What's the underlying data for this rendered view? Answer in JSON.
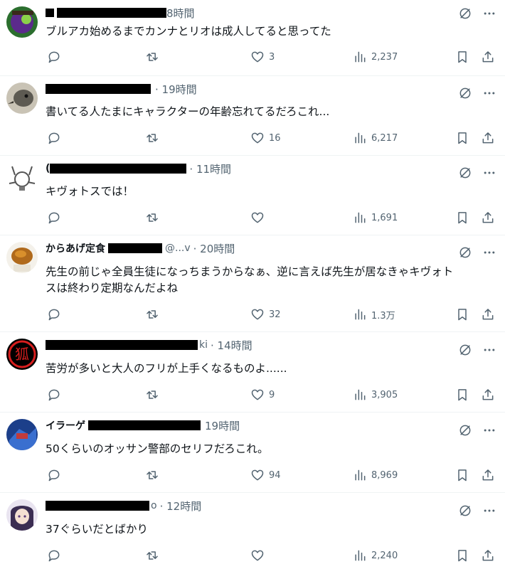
{
  "tweets": [
    {
      "name_visible": "",
      "handle_visible": "",
      "time": "8時間",
      "text": "ブルアカ始めるまでカンナとリオは成人してると思ってた",
      "likes": "3",
      "views": "2,237",
      "replies": "",
      "retweets": ""
    },
    {
      "name_visible": "",
      "handle_visible": "",
      "time": "· 19時間",
      "text": "書いてる人たまにキャラクターの年齢忘れてるだろこれ...",
      "likes": "16",
      "views": "6,217",
      "replies": "",
      "retweets": ""
    },
    {
      "name_visible": "(",
      "handle_visible": "",
      "time": "· 11時間",
      "text": "キヴォトスでは！",
      "likes": "",
      "views": "1,691",
      "replies": "",
      "retweets": ""
    },
    {
      "name_visible": "からあげ定食",
      "handle_visible": "@...v",
      "time": "· 20時間",
      "text": "先生の前じゃ全員生徒になっちまうからなぁ、逆に言えば先生が居なきゃキヴォトスは終わり定期なんだよね",
      "likes": "32",
      "views": "1.3万",
      "replies": "",
      "retweets": ""
    },
    {
      "name_visible": "",
      "handle_visible": "ki",
      "time": "· 14時間",
      "text": "苦労が多いと大人のフリが上手くなるものよ......",
      "likes": "9",
      "views": "3,905",
      "replies": "",
      "retweets": ""
    },
    {
      "name_visible": "イラーゲ",
      "handle_visible": "",
      "time": "19時間",
      "text": "50くらいのオッサン警部のセリフだろこれ。",
      "likes": "94",
      "views": "8,969",
      "replies": "",
      "retweets": ""
    },
    {
      "name_visible": "",
      "handle_visible": "o",
      "time": "· 12時間",
      "text": "37ぐらいだとばかり",
      "likes": "",
      "views": "2,240",
      "replies": "",
      "retweets": ""
    }
  ],
  "colors": {
    "text": "#0f1419",
    "muted": "#536471",
    "divider": "#eff3f4"
  },
  "icons": [
    "grok-icon",
    "more-icon",
    "reply-icon",
    "retweet-icon",
    "like-icon",
    "views-icon",
    "bookmark-icon",
    "share-icon"
  ]
}
